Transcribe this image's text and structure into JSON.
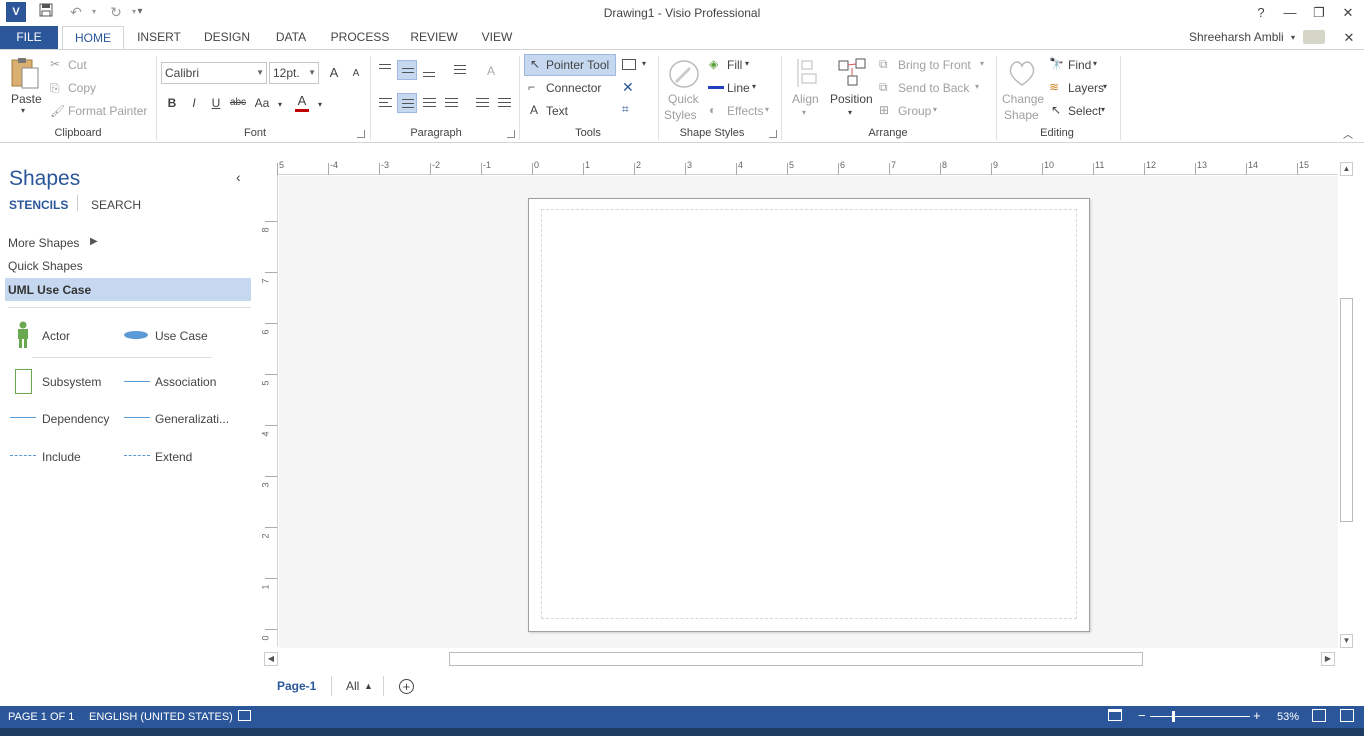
{
  "window": {
    "title": "Drawing1 - Visio Professional",
    "help": "?",
    "minimize": "—",
    "restore": "❐",
    "close": "✕",
    "user": "Shreeharsh Ambli",
    "ribbon_close": "✕"
  },
  "tabs": [
    "FILE",
    "HOME",
    "INSERT",
    "DESIGN",
    "DATA",
    "PROCESS",
    "REVIEW",
    "VIEW"
  ],
  "clipboard": {
    "paste": "Paste",
    "cut": "Cut",
    "copy": "Copy",
    "format_painter": "Format Painter",
    "label": "Clipboard"
  },
  "font": {
    "name": "Calibri",
    "size": "12pt.",
    "grow": "A",
    "shrink": "A",
    "bold": "B",
    "italic": "I",
    "underline": "U",
    "strike": "abc",
    "case": "Aa",
    "color_letter": "A",
    "label": "Font"
  },
  "paragraph": {
    "label": "Paragraph"
  },
  "tools": {
    "pointer": "Pointer Tool",
    "connector": "Connector",
    "text": "Text",
    "text_icon": "A",
    "label": "Tools"
  },
  "shape_styles": {
    "quick_styles_1": "Quick",
    "quick_styles_2": "Styles",
    "fill": "Fill",
    "line": "Line",
    "effects": "Effects",
    "label": "Shape Styles"
  },
  "arrange": {
    "align": "Align",
    "position": "Position",
    "bring_front": "Bring to Front",
    "send_back": "Send to Back",
    "group": "Group",
    "label": "Arrange"
  },
  "editing": {
    "change_shape_1": "Change",
    "change_shape_2": "Shape",
    "find": "Find",
    "layers": "Layers",
    "select": "Select",
    "label": "Editing"
  },
  "shapes_pane": {
    "title": "Shapes",
    "tab_stencils": "STENCILS",
    "tab_search": "SEARCH",
    "collapse": "‹",
    "nav": [
      "More Shapes",
      "Quick Shapes",
      "UML Use Case"
    ],
    "items": [
      "Actor",
      "Use Case",
      "Subsystem",
      "Association",
      "Dependency",
      "Generalizati...",
      "Include",
      "Extend"
    ]
  },
  "ruler": {
    "top": [
      "5",
      "-4",
      "-3",
      "-2",
      "-1",
      "0",
      "1",
      "2",
      "3",
      "4",
      "5",
      "6",
      "7",
      "8",
      "9",
      "10",
      "11",
      "12",
      "13",
      "14",
      "15"
    ],
    "left": [
      "8",
      "7",
      "6",
      "5",
      "4",
      "3",
      "2",
      "1",
      "0"
    ]
  },
  "page_tabs": {
    "page": "Page-1",
    "all": "All",
    "add": "+"
  },
  "status": {
    "page": "PAGE 1 OF 1",
    "language": "ENGLISH (UNITED STATES)",
    "zoom": "53%",
    "zoom_minus": "−",
    "zoom_plus": "+"
  },
  "colors": {
    "accent": "#2b579a",
    "selected": "#c5d8f0"
  }
}
